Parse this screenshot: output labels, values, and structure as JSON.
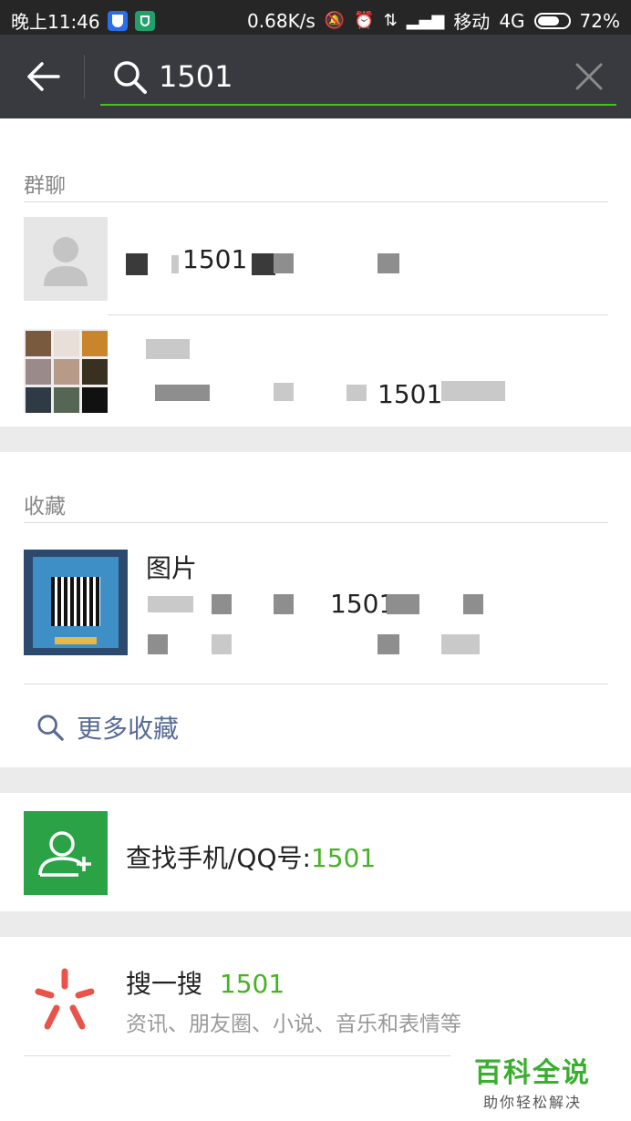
{
  "status": {
    "time": "晚上11:46",
    "speed": "0.68K/s",
    "carrier": "移动",
    "network": "4G",
    "battery": "72%",
    "battery_level": 0.72
  },
  "search": {
    "query": "1501"
  },
  "group_chat": {
    "title": "群聊",
    "item1_match": "1501",
    "item2_match": "1501"
  },
  "favorites": {
    "title": "收藏",
    "item_type": "图片",
    "item_match": "1501",
    "more_label": "更多收藏"
  },
  "find_contact": {
    "label": "查找手机/QQ号:",
    "query": "1501"
  },
  "sou": {
    "label": "搜一搜",
    "query": "1501",
    "subtitle": "资讯、朋友圈、小说、音乐和表情等"
  },
  "watermark": {
    "title": "百科全说",
    "subtitle": "助你轻松解决"
  },
  "colors": {
    "accent_green": "#46b224",
    "link_blue": "#576b95",
    "header_bg": "#393a3f"
  }
}
